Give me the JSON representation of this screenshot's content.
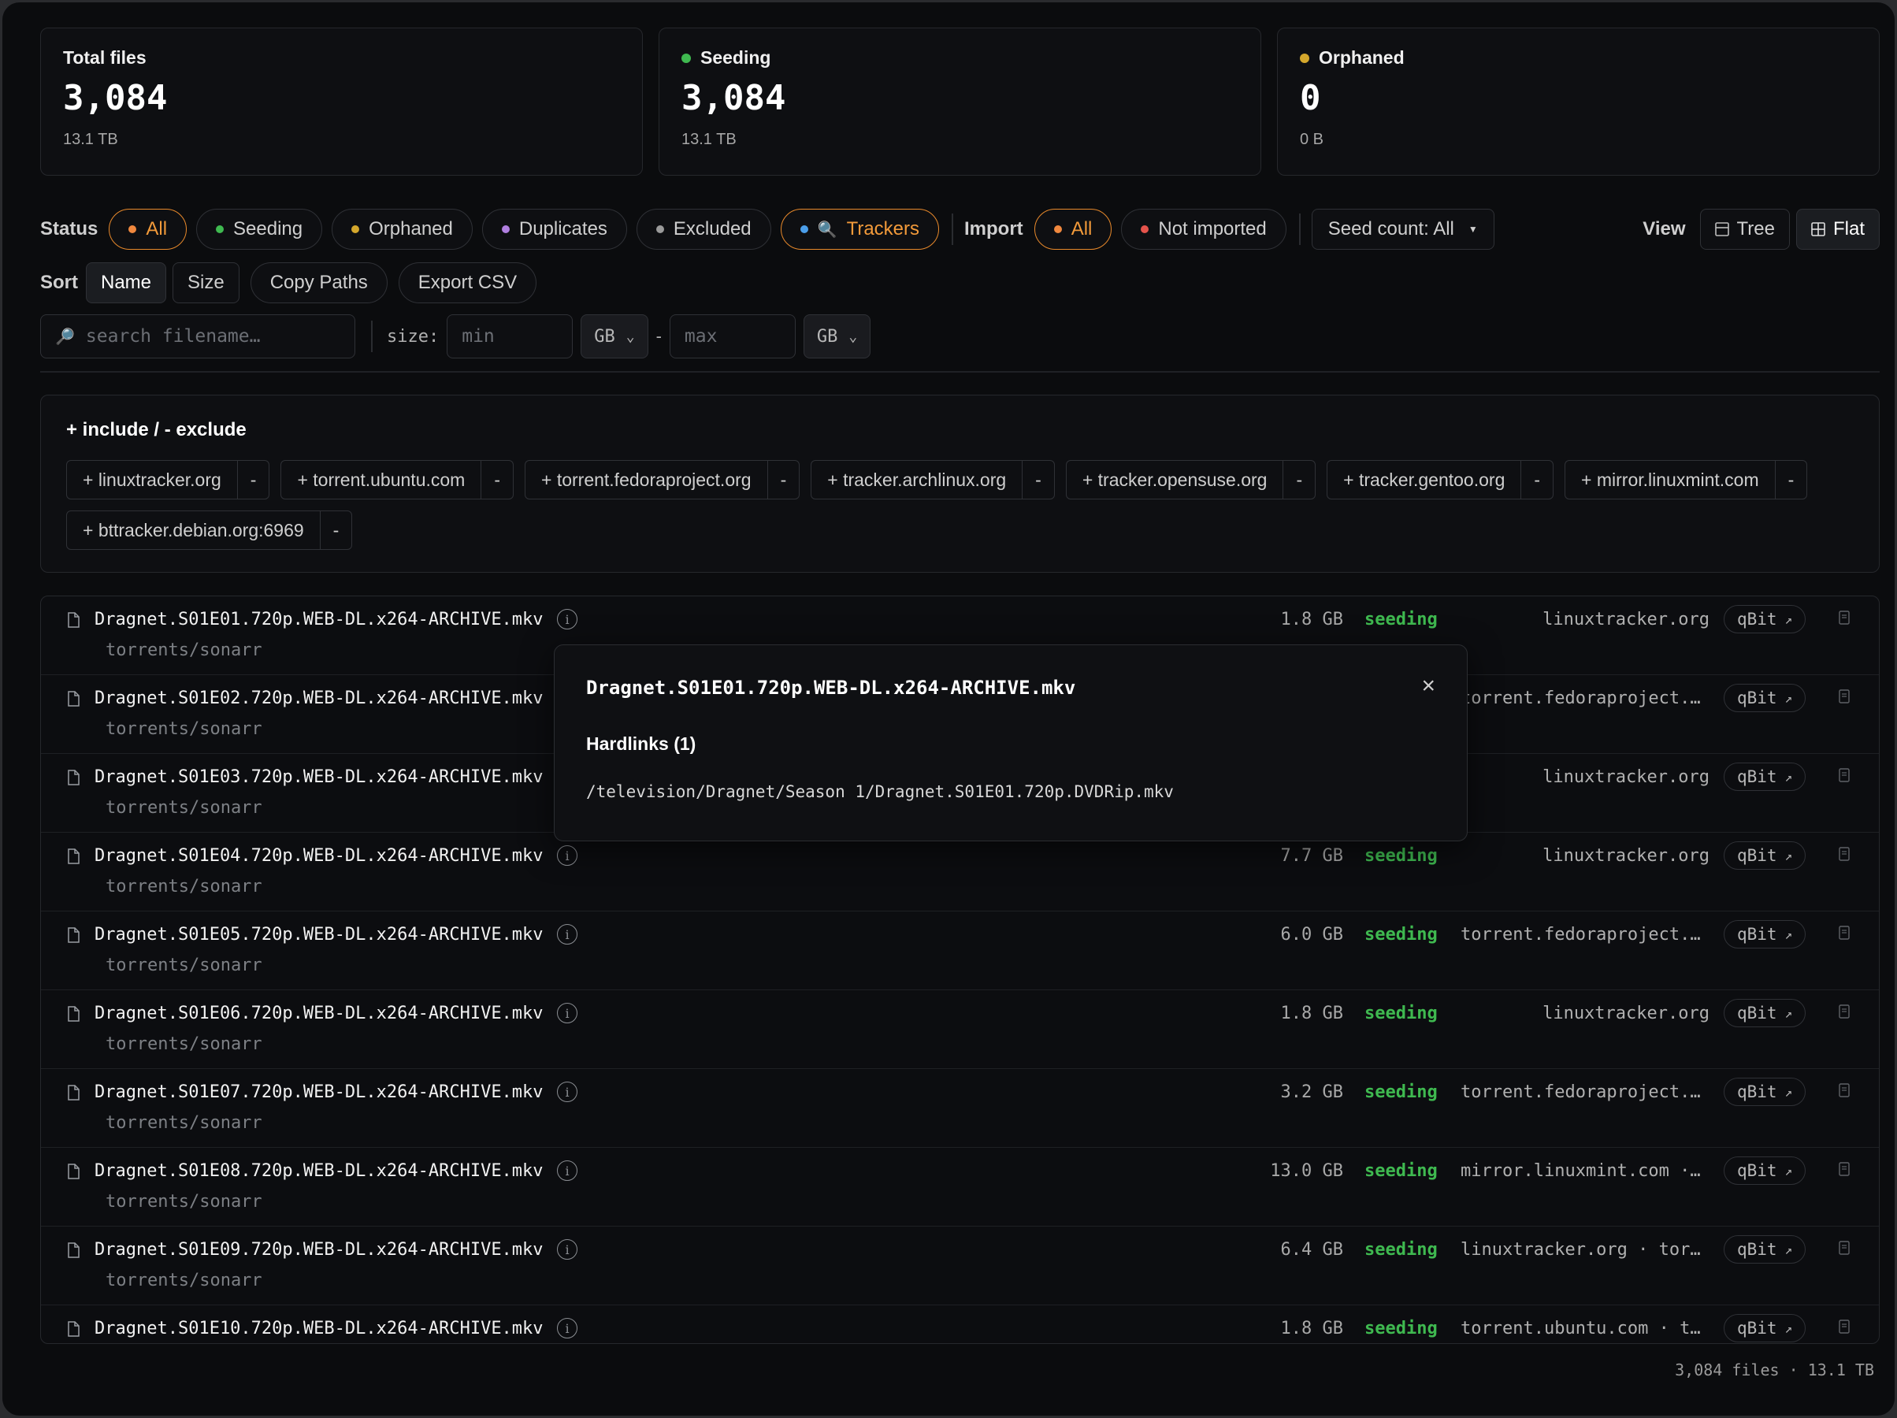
{
  "stats": [
    {
      "label": "Total files",
      "value": "3,084",
      "sub": "13.1 TB",
      "dot": ""
    },
    {
      "label": "Seeding",
      "value": "3,084",
      "sub": "13.1 TB",
      "dot": "#3fb950"
    },
    {
      "label": "Orphaned",
      "value": "0",
      "sub": "0 B",
      "dot": "#d4a72c"
    }
  ],
  "status_filter": {
    "label": "Status",
    "items": [
      {
        "label": "All",
        "dot": "#f0883e",
        "active": true
      },
      {
        "label": "Seeding",
        "dot": "#3fb950",
        "active": false
      },
      {
        "label": "Orphaned",
        "dot": "#d4a72c",
        "active": false
      },
      {
        "label": "Duplicates",
        "dot": "#b07fe0",
        "active": false
      },
      {
        "label": "Excluded",
        "dot": "#9a9a9a",
        "active": false
      },
      {
        "label": "Trackers",
        "dot": "#4b9eea",
        "icon": "🔍",
        "active": true
      }
    ]
  },
  "import_filter": {
    "label": "Import",
    "items": [
      {
        "label": "All",
        "dot": "#f0883e",
        "active": true
      },
      {
        "label": "Not imported",
        "dot": "#e5534b",
        "active": false
      }
    ]
  },
  "seed_count": "Seed count: All",
  "view": {
    "label": "View",
    "tree": "Tree",
    "flat": "Flat"
  },
  "sort": {
    "label": "Sort",
    "name": "Name",
    "size": "Size",
    "copy_paths": "Copy Paths",
    "export_csv": "Export CSV"
  },
  "search": {
    "placeholder": "search filename…",
    "size_label": "size:",
    "min_placeholder": "min",
    "max_placeholder": "max",
    "unit_min": "GB",
    "unit_max": "GB",
    "dash": "-"
  },
  "tracker_panel": {
    "title": "+ include / - exclude",
    "trackers": [
      "+ linuxtracker.org",
      "+ torrent.ubuntu.com",
      "+ torrent.fedoraproject.org",
      "+ tracker.archlinux.org",
      "+ tracker.opensuse.org",
      "+ tracker.gentoo.org",
      "+ mirror.linuxmint.com",
      "+ bttracker.debian.org:6969"
    ],
    "exclude_label": "-"
  },
  "files": [
    {
      "name": "Dragnet.S01E01.720p.WEB-DL.x264-ARCHIVE.mkv",
      "path": "torrents/sonarr",
      "size": "1.8 GB",
      "status": "seeding",
      "tracker": "linuxtracker.org"
    },
    {
      "name": "Dragnet.S01E02.720p.WEB-DL.x264-ARCHIVE.mkv",
      "path": "torrents/sonarr",
      "size": "",
      "status": "",
      "tracker": "torrent.fedoraproject.o…"
    },
    {
      "name": "Dragnet.S01E03.720p.WEB-DL.x264-ARCHIVE.mkv",
      "path": "torrents/sonarr",
      "size": "",
      "status": "",
      "tracker": "linuxtracker.org"
    },
    {
      "name": "Dragnet.S01E04.720p.WEB-DL.x264-ARCHIVE.mkv",
      "path": "torrents/sonarr",
      "size": "7.7 GB",
      "status": "seeding",
      "tracker": "linuxtracker.org"
    },
    {
      "name": "Dragnet.S01E05.720p.WEB-DL.x264-ARCHIVE.mkv",
      "path": "torrents/sonarr",
      "size": "6.0 GB",
      "status": "seeding",
      "tracker": "torrent.fedoraproject.o…"
    },
    {
      "name": "Dragnet.S01E06.720p.WEB-DL.x264-ARCHIVE.mkv",
      "path": "torrents/sonarr",
      "size": "1.8 GB",
      "status": "seeding",
      "tracker": "linuxtracker.org"
    },
    {
      "name": "Dragnet.S01E07.720p.WEB-DL.x264-ARCHIVE.mkv",
      "path": "torrents/sonarr",
      "size": "3.2 GB",
      "status": "seeding",
      "tracker": "torrent.fedoraproject.o…"
    },
    {
      "name": "Dragnet.S01E08.720p.WEB-DL.x264-ARCHIVE.mkv",
      "path": "torrents/sonarr",
      "size": "13.0 GB",
      "status": "seeding",
      "tracker": "mirror.linuxmint.com · …"
    },
    {
      "name": "Dragnet.S01E09.720p.WEB-DL.x264-ARCHIVE.mkv",
      "path": "torrents/sonarr",
      "size": "6.4 GB",
      "status": "seeding",
      "tracker": "linuxtracker.org · torr…"
    },
    {
      "name": "Dragnet.S01E10.720p.WEB-DL.x264-ARCHIVE.mkv",
      "path": "torrents/sonarr",
      "size": "1.8 GB",
      "status": "seeding",
      "tracker": "torrent.ubuntu.com · to…"
    }
  ],
  "qbit_label": "qBit",
  "popover": {
    "title": "Dragnet.S01E01.720p.WEB-DL.x264-ARCHIVE.mkv",
    "subtitle": "Hardlinks (1)",
    "path": "/television/Dragnet/Season 1/Dragnet.S01E01.720p.DVDRip.mkv",
    "close": "×"
  },
  "footer": "3,084 files · 13.1 TB"
}
